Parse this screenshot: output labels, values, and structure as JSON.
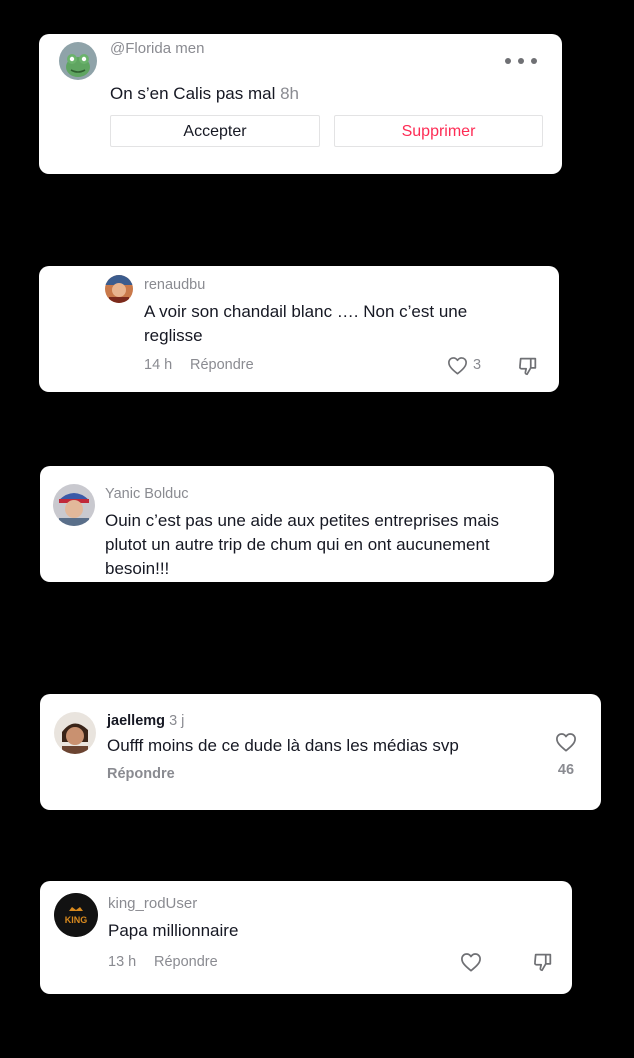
{
  "notification": {
    "username": "@Florida men",
    "message": "On s’en Calis pas mal",
    "time": "8h",
    "accept_label": "Accepter",
    "delete_label": "Supprimer",
    "more_icon": "more-dots-icon",
    "delete_color": "#fe2c55"
  },
  "comments": [
    {
      "username": "renaudbu",
      "text": "A voir son chandail blanc …. Non c’est une reglisse",
      "time": "14 h",
      "reply": "Répondre",
      "likes": "3",
      "icons": [
        "heart-icon",
        "dislike-icon"
      ]
    },
    {
      "username": "Yanic Bolduc",
      "text": "Ouin c’est pas une aide aux petites entreprises mais plutot un autre trip de chum qui en ont aucunement besoin!!!"
    },
    {
      "username": "jaellemg",
      "time": "3 j",
      "text": "Oufff moins de ce dude là dans les médias svp",
      "reply": "Répondre",
      "likes": "46",
      "icons": [
        "heart-icon"
      ]
    },
    {
      "username": "king_rodUser",
      "text": "Papa millionnaire",
      "time": "13 h",
      "reply": "Répondre",
      "avatar_text": "KING",
      "icons": [
        "heart-icon",
        "dislike-icon"
      ]
    }
  ]
}
